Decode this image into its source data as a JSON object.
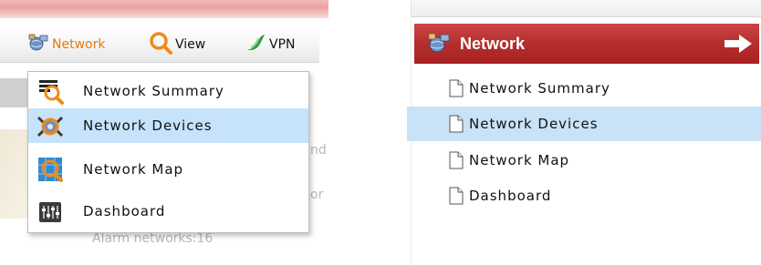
{
  "toolbar": {
    "items": [
      {
        "label": "Network",
        "icon": "network-globe-icon",
        "color": "#e07a10"
      },
      {
        "label": "View",
        "icon": "magnifier-icon"
      },
      {
        "label": "VPN",
        "icon": "vpn-swoosh-icon"
      }
    ]
  },
  "dropdown": {
    "items": [
      {
        "label": "Network Summary",
        "icon": "network-summary-icon",
        "selected": false
      },
      {
        "label": "Network Devices",
        "icon": "network-devices-icon",
        "selected": true
      },
      {
        "label": "Network Map",
        "icon": "network-map-icon",
        "selected": false
      },
      {
        "label": "Dashboard",
        "icon": "dashboard-icon",
        "selected": false
      }
    ]
  },
  "background_text": {
    "fragment_1": "nd",
    "fragment_2": "or",
    "fragment_3": "Alarm networks:16"
  },
  "side_nav": {
    "header": {
      "title": "Network",
      "icon": "network-globe-icon",
      "arrow_icon": "arrow-right-icon",
      "color": "#b52e2e"
    },
    "items": [
      {
        "label": "Network Summary",
        "icon": "page-icon",
        "selected": false
      },
      {
        "label": "Network Devices",
        "icon": "page-icon",
        "selected": true
      },
      {
        "label": "Network Map",
        "icon": "page-icon",
        "selected": false
      },
      {
        "label": "Dashboard",
        "icon": "page-icon",
        "selected": false
      }
    ]
  },
  "colors": {
    "selection": "#c6e3fb",
    "header_red": "#b52e2e",
    "orange_accent": "#e07a10"
  }
}
